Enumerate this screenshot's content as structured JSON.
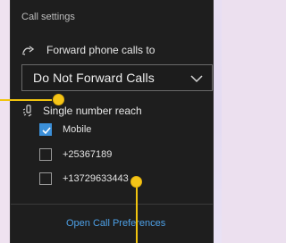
{
  "panel": {
    "title": "Call settings",
    "forward": {
      "label": "Forward phone calls to",
      "icon": "call-forward-icon",
      "selected_value": "Do Not Forward Calls"
    },
    "single_number_reach": {
      "label": "Single number reach",
      "icon": "single-number-reach-icon",
      "options": [
        {
          "label": "Mobile",
          "checked": true
        },
        {
          "label": "+25367189",
          "checked": false
        },
        {
          "label": "+13729633443",
          "checked": false
        }
      ]
    },
    "footer_link": "Open Call Preferences"
  },
  "colors": {
    "panel_bg": "#1e1e1e",
    "accent_blue": "#3b8fd8",
    "link_blue": "#4da0e6",
    "callout_yellow": "#f5c518"
  }
}
